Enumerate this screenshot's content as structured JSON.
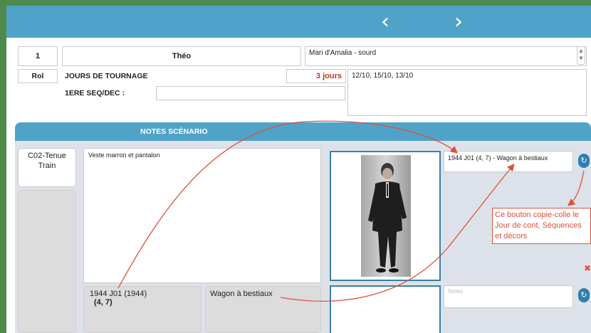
{
  "nav": {
    "prev_icon": "‹",
    "next_icon": "›"
  },
  "role": {
    "number": "1",
    "name": "Théo",
    "description": "Mari d'Amalia - sourd",
    "role_label": "Rol",
    "shooting_days_label": "JOURS DE TOURNAGE",
    "shooting_days_count": "3 jours",
    "shooting_dates": "12/10, 15/10, 13/10",
    "first_seq_label": "1ERE SEQ/DEC :",
    "first_seq_value": ""
  },
  "notes_section": {
    "title": "NOTES SCÉNARIO"
  },
  "costume": {
    "code": "C02-Tenue Train",
    "description": "Veste marron et pantalon",
    "day_info": "1944 J01 (1944)",
    "sequences": "(4, 7)",
    "decor": "Wagon à bestiaux",
    "photo_alt": "Homme en costume sombre"
  },
  "side": {
    "copied_field": "1944 J01 (4, 7) - Wagon à bestiaux",
    "notes_placeholder": "Notes",
    "annotation": "Ce bouton copie-colle le Jour de cont, Séquences et décors",
    "refresh_icon": "↻",
    "close_icon": "✖"
  },
  "colors": {
    "header_blue": "#4fa3c8",
    "frame_blue": "#3b7fa3",
    "annotation_red": "#e0503a",
    "days_red": "#b53a2a"
  }
}
